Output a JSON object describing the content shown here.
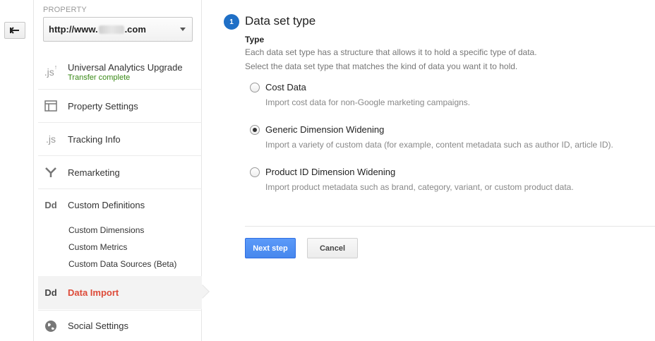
{
  "sidebar": {
    "property_label": "PROPERTY",
    "property_prefix": "http://www.",
    "property_suffix": ".com",
    "items": [
      {
        "icon": "js-upgrade-icon",
        "label": "Universal Analytics Upgrade",
        "sublabel": "Transfer complete"
      },
      {
        "icon": "property-settings-icon",
        "label": "Property Settings"
      },
      {
        "icon": "js-icon",
        "label": "Tracking Info"
      },
      {
        "icon": "remarketing-icon",
        "label": "Remarketing"
      },
      {
        "icon": "dd-icon",
        "label": "Custom Definitions"
      }
    ],
    "sub_items": [
      "Custom Dimensions",
      "Custom Metrics",
      "Custom Data Sources (Beta)"
    ],
    "active_item": {
      "icon": "dd-icon",
      "label": "Data Import"
    },
    "last_item": {
      "icon": "globe-icon",
      "label": "Social Settings"
    }
  },
  "main": {
    "step_number": "1",
    "step_title": "Data set type",
    "type_label": "Type",
    "desc_line1": "Each data set type has a structure that allows it to hold a specific type of data.",
    "desc_line2": "Select the data set type that matches the kind of data you want it to hold.",
    "options": [
      {
        "label": "Cost Data",
        "desc": "Import cost data for non-Google marketing campaigns.",
        "checked": false
      },
      {
        "label": "Generic Dimension Widening",
        "desc": "Import a variety of custom data (for example, content metadata such as author ID, article ID).",
        "checked": true
      },
      {
        "label": "Product ID Dimension Widening",
        "desc": "Import product metadata such as brand, category, variant, or custom product data.",
        "checked": false
      }
    ],
    "next_label": "Next step",
    "cancel_label": "Cancel"
  },
  "colors": {
    "accent": "#1f6fc6",
    "active_text": "#dd4b39",
    "success": "#3a8a17",
    "primary_button": "#4787ed"
  }
}
